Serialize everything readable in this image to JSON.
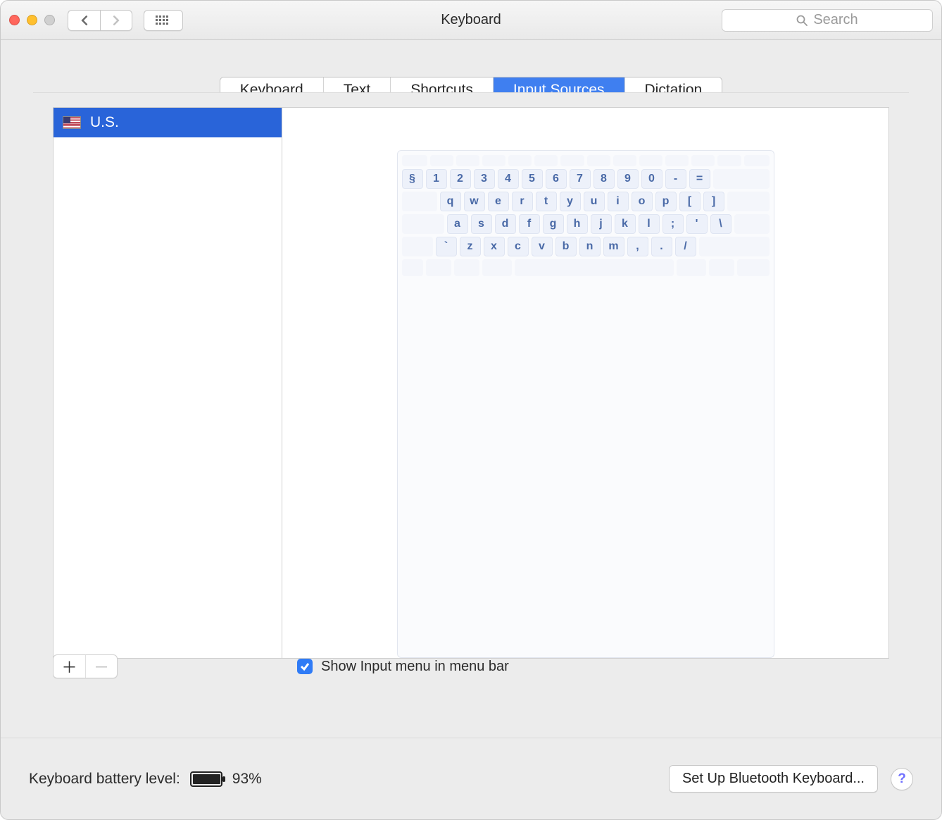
{
  "window": {
    "title": "Keyboard"
  },
  "search": {
    "placeholder": "Search"
  },
  "tabs": [
    {
      "label": "Keyboard",
      "active": false
    },
    {
      "label": "Text",
      "active": false
    },
    {
      "label": "Shortcuts",
      "active": false
    },
    {
      "label": "Input Sources",
      "active": true
    },
    {
      "label": "Dictation",
      "active": false
    }
  ],
  "sources": [
    {
      "label": "U.S.",
      "flag": "us",
      "selected": true
    }
  ],
  "keyboard_rows": {
    "r1": [
      "§",
      "1",
      "2",
      "3",
      "4",
      "5",
      "6",
      "7",
      "8",
      "9",
      "0",
      "-",
      "="
    ],
    "r2": [
      "q",
      "w",
      "e",
      "r",
      "t",
      "y",
      "u",
      "i",
      "o",
      "p",
      "[",
      "]"
    ],
    "r3": [
      "a",
      "s",
      "d",
      "f",
      "g",
      "h",
      "j",
      "k",
      "l",
      ";",
      "'",
      "\\"
    ],
    "r4": [
      "`",
      "z",
      "x",
      "c",
      "v",
      "b",
      "n",
      "m",
      ",",
      ".",
      "/"
    ]
  },
  "show_input_menu": {
    "label": "Show Input menu in menu bar",
    "checked": true
  },
  "footer": {
    "battery_label": "Keyboard battery level:",
    "battery_pct": "93%",
    "bluetooth_button": "Set Up Bluetooth Keyboard..."
  }
}
